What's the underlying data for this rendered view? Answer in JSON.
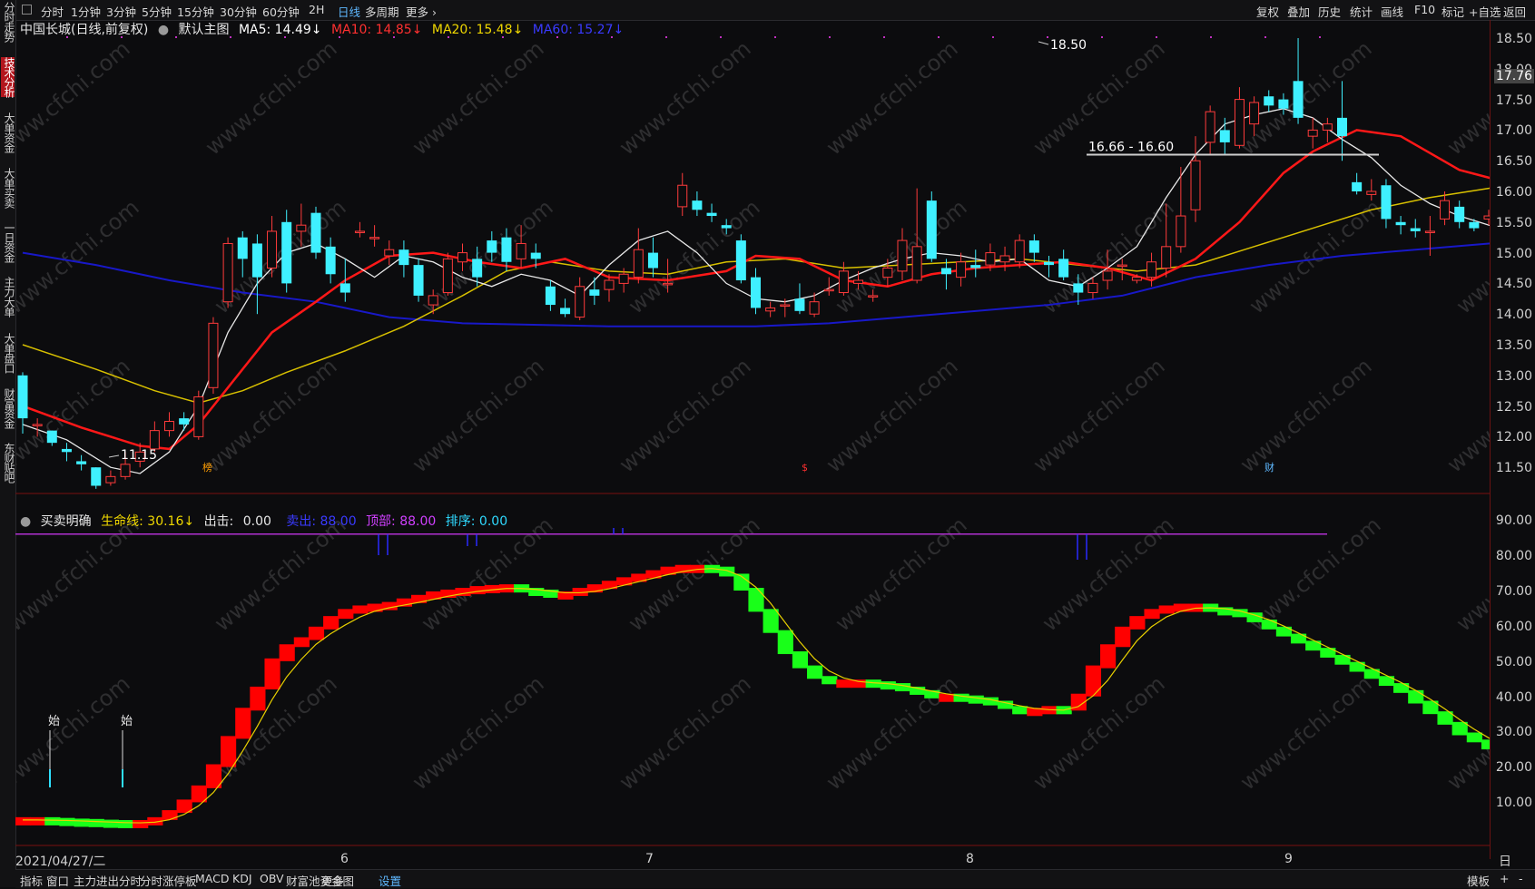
{
  "toolbar": {
    "left": [
      "分时",
      "1分钟",
      "3分钟",
      "5分钟",
      "15分钟",
      "30分钟",
      "60分钟",
      "2H",
      "日线",
      "多周期",
      "更多 ›"
    ],
    "right": [
      "复权",
      "叠加",
      "历史",
      "统计",
      "画线",
      "F10",
      "标记",
      "+自选",
      "返回"
    ]
  },
  "sidebar": [
    "分时走势",
    "技术分析",
    "大单资金",
    "大单买卖",
    "一日资金",
    "主力大单",
    "大单盘口",
    "财富资金",
    "东财贴吧"
  ],
  "main_legend": {
    "title": "中国长城(日线,前复权)",
    "mode": "默认主图",
    "ma5": "MA5: 14.49↓",
    "ma10": "MA10: 14.85↓",
    "ma20": "MA20: 15.48↓",
    "ma60": "MA60: 15.27↓"
  },
  "sub_legend": {
    "name": "买卖明确",
    "life": "生命线: 30.16↓",
    "out_label": "出击:",
    "out_value": "0.00",
    "sell": "卖出: 88.00",
    "top": "顶部: 88.00",
    "rank": "排序: 0.00"
  },
  "price_axis": [
    "18.50",
    "18.00",
    "17.50",
    "17.00",
    "16.50",
    "16.00",
    "15.50",
    "15.00",
    "14.50",
    "14.00",
    "13.50",
    "13.00",
    "12.50",
    "12.00",
    "11.50"
  ],
  "current_price": "17.76",
  "osc_axis": [
    "90.00",
    "80.00",
    "70.00",
    "60.00",
    "50.00",
    "40.00",
    "30.00",
    "20.00",
    "10.00"
  ],
  "annotations": {
    "high": "18.50",
    "low": "11.15",
    "level": "16.66 - 16.60",
    "start1": "始",
    "start2": "始",
    "tag_bang": "榜",
    "tag_s": "$",
    "tag_cai": "财"
  },
  "date_axis": {
    "start": "2021/04/27/二",
    "months": [
      "6",
      "7",
      "8",
      "9"
    ],
    "period": "日线"
  },
  "bottom_tabs": [
    "指标",
    "窗口",
    "主力进出分时",
    "分时涨停板",
    "MACD",
    "KDJ",
    "OBV",
    "财富池资金图",
    "更多",
    "设置"
  ],
  "bottom_right": [
    "模板",
    "+",
    "-"
  ],
  "watermark": "www.cfchi.com",
  "colors": {
    "up": "#ff3b3b",
    "down": "#3ff0ff",
    "ma5": "#ffffff",
    "ma10": "#ff2020",
    "ma20": "#e8d000",
    "ma60": "#2020d0",
    "osc_up": "#ff0000",
    "osc_down": "#19ff19"
  }
}
